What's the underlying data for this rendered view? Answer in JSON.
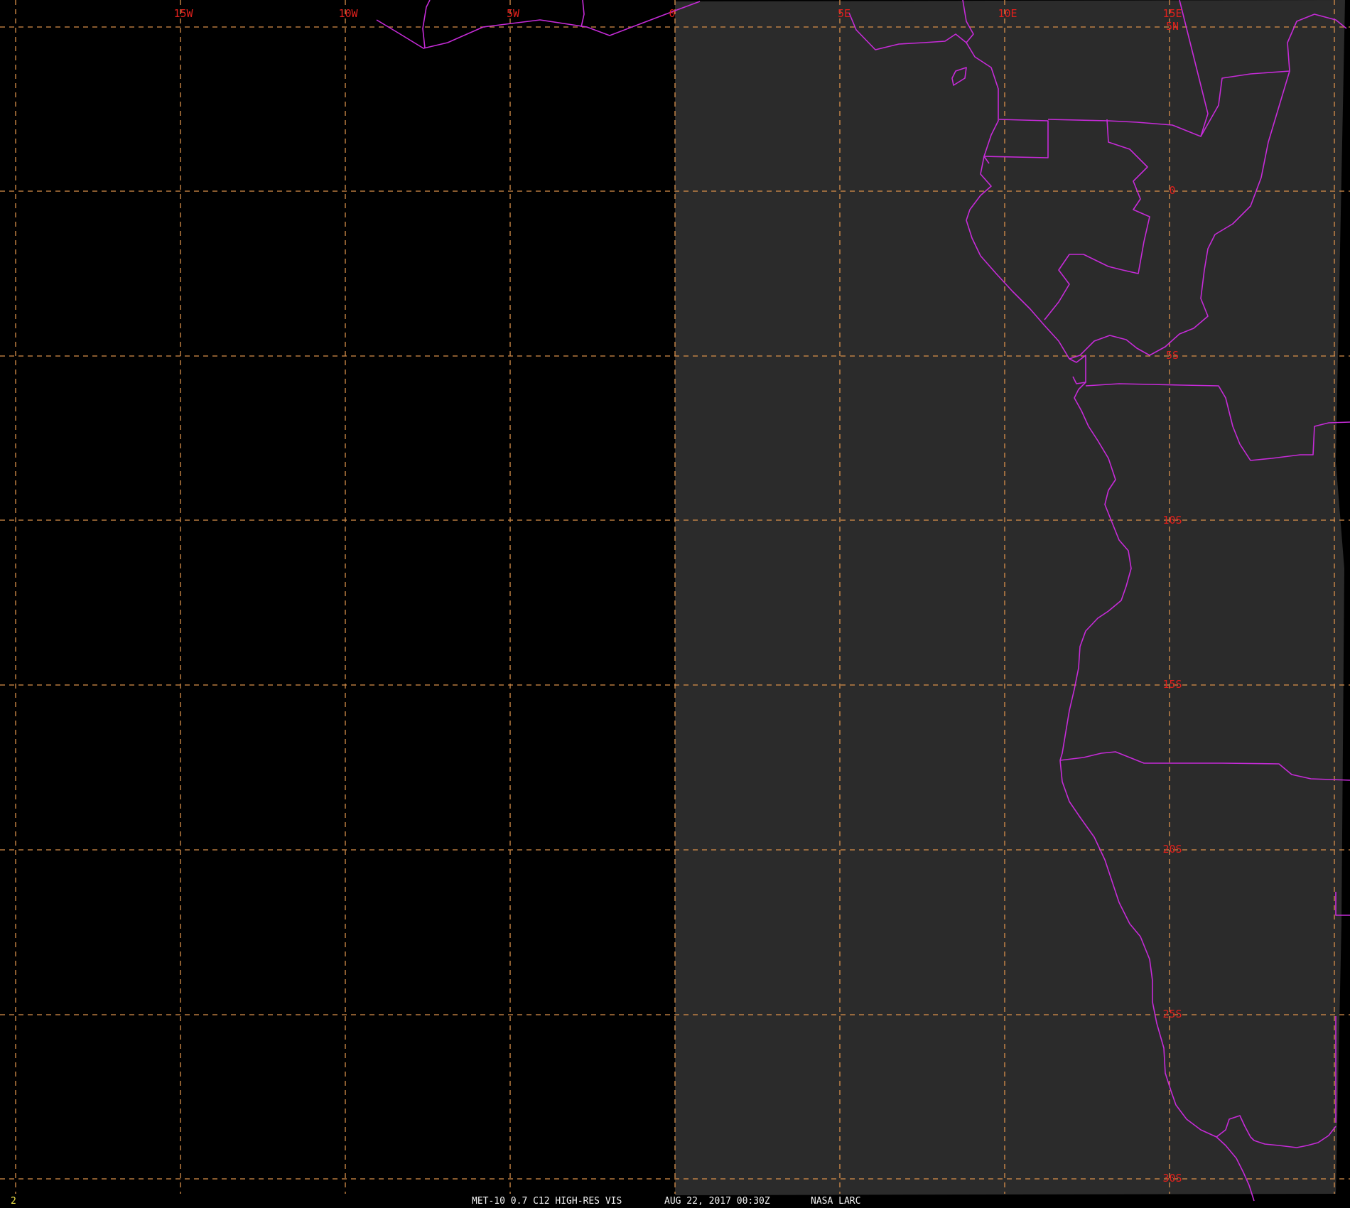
{
  "image": {
    "satellite_extent_note": "",
    "colors": {
      "background": "#000000",
      "satellite_disk": "#2b2b2b",
      "gridlines": "#d9904a",
      "grid_labels": "#e0201c",
      "coastlines_borders": "#c62bd8",
      "footer_text": "#f2f2f2",
      "frame_number": "#f2e64a"
    }
  },
  "grid": {
    "longitude_labels": [
      "15W",
      "10W",
      "5W",
      "0",
      "5E",
      "10E",
      "15E"
    ],
    "latitude_labels": [
      "5N",
      "0",
      "5S",
      "10S",
      "15S",
      "20S",
      "25S",
      "30S"
    ]
  },
  "footer": {
    "frame_number": "2",
    "product": "MET-10 0.7 C12 HIGH-RES VIS",
    "datetime": "AUG 22, 2017 00:30Z",
    "credit": "NASA LARC"
  }
}
